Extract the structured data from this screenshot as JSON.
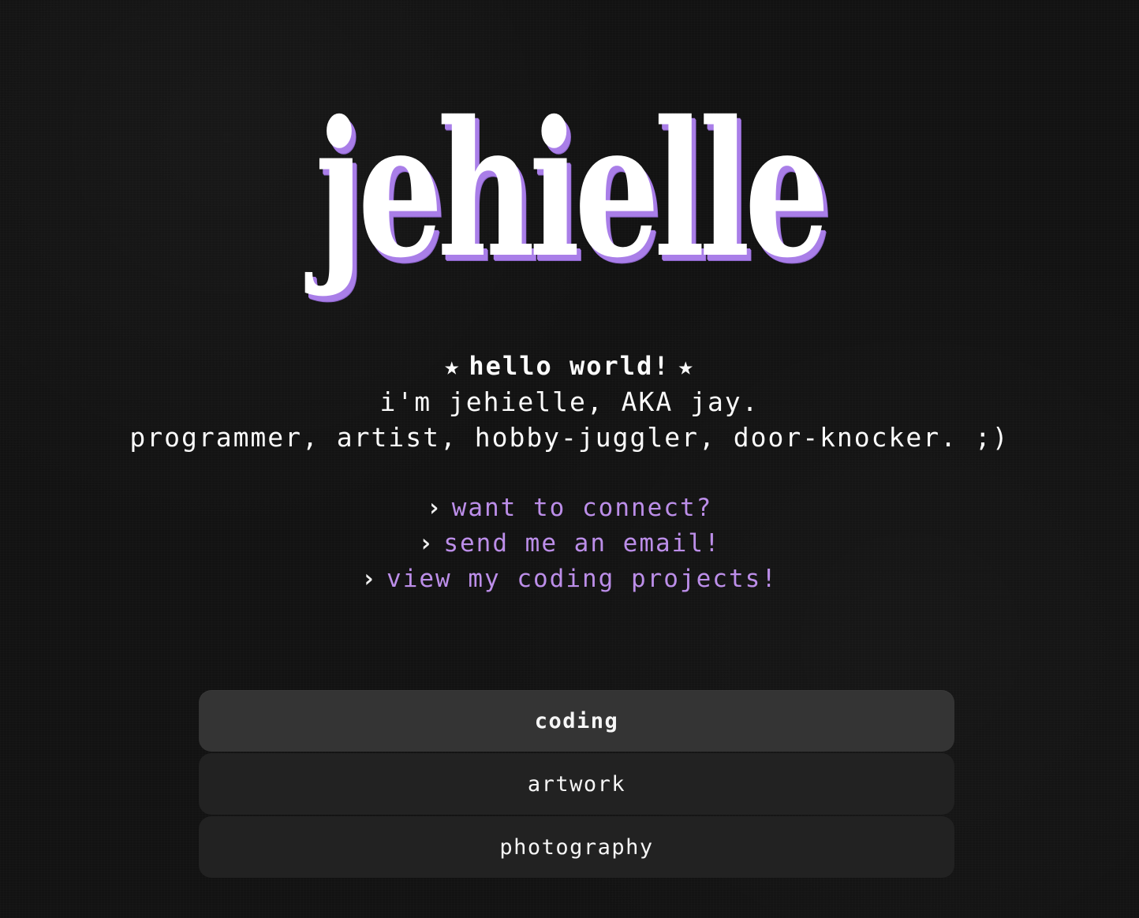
{
  "site": {
    "logo_text": "jehielle"
  },
  "intro": {
    "star_left": "★",
    "headline": "hello world!",
    "star_right": "★",
    "line1": "i'm jehielle, AKA jay.",
    "line2": "programmer, artist, hobby-juggler, door-knocker. ;)"
  },
  "links": [
    {
      "chevron": "›",
      "label": "want to connect?"
    },
    {
      "chevron": "›",
      "label": "send me an email!"
    },
    {
      "chevron": "›",
      "label": "view my coding projects!"
    }
  ],
  "tabs": [
    {
      "label": "coding",
      "active": true
    },
    {
      "label": "artwork",
      "active": false
    },
    {
      "label": "photography",
      "active": false
    }
  ],
  "colors": {
    "background": "#121212",
    "accent": "#bc8ee9",
    "logo_shadow": "#a97ee8",
    "tab_active": "#343434",
    "tab_inactive": "#222222"
  },
  "icons": {
    "star": "star-icon",
    "chevron": "chevron-right-icon"
  }
}
